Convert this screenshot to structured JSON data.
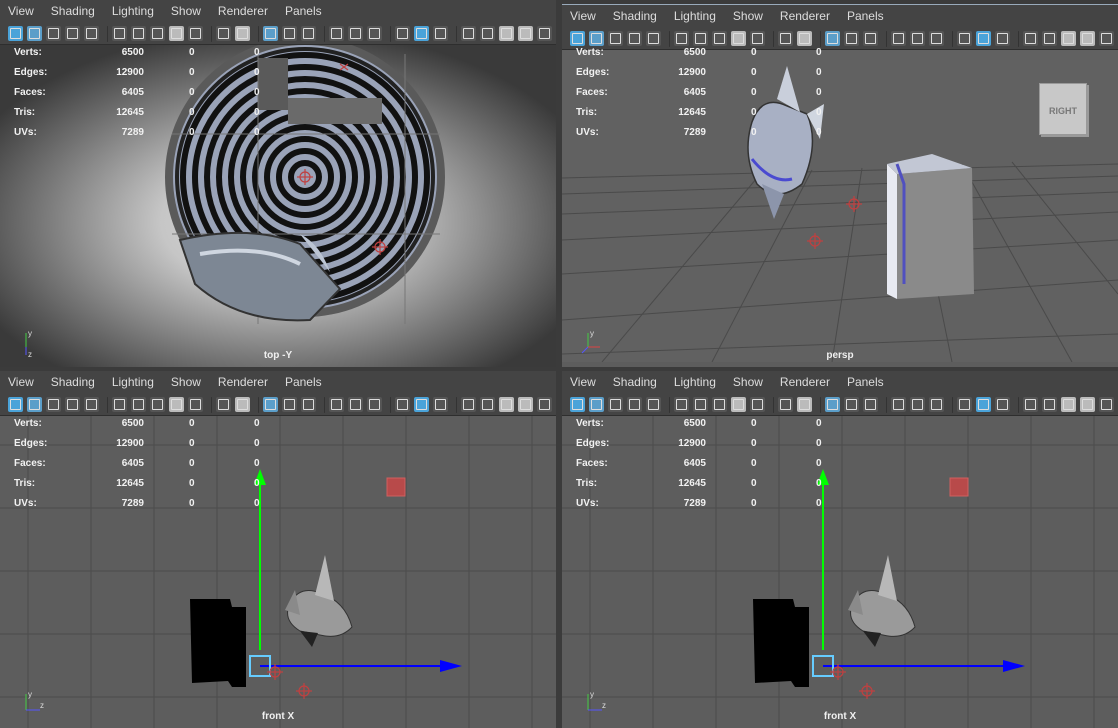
{
  "menus": [
    "View",
    "Shading",
    "Lighting",
    "Show",
    "Renderer",
    "Panels"
  ],
  "hud": [
    {
      "label": "Verts:",
      "value": "6500",
      "z1": "0",
      "z2": "0"
    },
    {
      "label": "Edges:",
      "value": "12900",
      "z1": "0",
      "z2": "0"
    },
    {
      "label": "Faces:",
      "value": "6405",
      "z1": "0",
      "z2": "0"
    },
    {
      "label": "Tris:",
      "value": "12645",
      "z1": "0",
      "z2": "0"
    },
    {
      "label": "UVs:",
      "value": "7289",
      "z1": "0",
      "z2": "0"
    }
  ],
  "viewports": {
    "top_left": {
      "camera": "top -Y"
    },
    "top_right": {
      "camera": "persp",
      "view_cube": "RIGHT"
    },
    "bottom_left": {
      "camera": "front X"
    },
    "bottom_right": {
      "camera": "front X"
    }
  },
  "axis_letters": {
    "y": "y",
    "z": "z"
  },
  "colors": {
    "accent": "#5b9ec9",
    "y_axis": "#00ff00",
    "z_axis": "#0000ff",
    "marker": "#c04040"
  }
}
